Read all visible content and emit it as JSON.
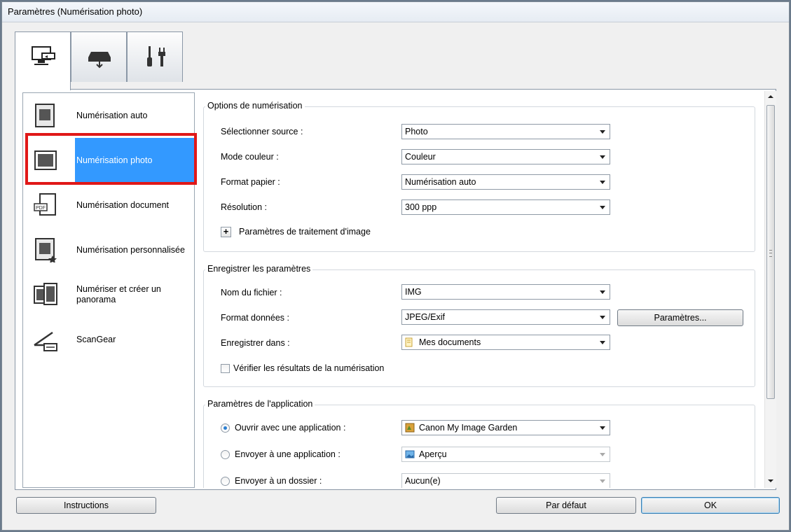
{
  "window": {
    "title": "Paramètres (Numérisation photo)"
  },
  "tabs": [
    {
      "icon": "scan-from-computer-icon",
      "active": true
    },
    {
      "icon": "scan-from-panel-icon",
      "active": false
    },
    {
      "icon": "general-settings-icon",
      "active": false
    }
  ],
  "sidebar": {
    "items": [
      {
        "label": "Numérisation auto",
        "icon": "auto-scan-icon"
      },
      {
        "label": "Numérisation photo",
        "icon": "photo-scan-icon",
        "selected": true
      },
      {
        "label": "Numérisation document",
        "icon": "document-scan-icon"
      },
      {
        "label": "Numérisation personnalisée",
        "icon": "custom-scan-icon"
      },
      {
        "label_line1": "Numériser et créer un",
        "label_line2": "panorama",
        "icon": "panorama-icon"
      },
      {
        "label": "ScanGear",
        "icon": "scangear-icon"
      }
    ]
  },
  "scan_options": {
    "title": "Options de numérisation",
    "source": {
      "label": "Sélectionner source :",
      "value": "Photo"
    },
    "color_mode": {
      "label": "Mode couleur :",
      "value": "Couleur"
    },
    "paper_size": {
      "label": "Format papier :",
      "value": "Numérisation auto"
    },
    "resolution": {
      "label": "Résolution :",
      "value": "300 ppp"
    },
    "image_processing": {
      "label": "Paramètres de traitement d'image"
    }
  },
  "save_settings": {
    "title": "Enregistrer les paramètres",
    "file_name": {
      "label": "Nom du fichier :",
      "value": "IMG"
    },
    "data_format": {
      "label": "Format données :",
      "value": "JPEG/Exif",
      "button": "Paramètres..."
    },
    "save_in": {
      "label": "Enregistrer dans :",
      "value": "Mes documents"
    },
    "check_results": {
      "label": "Vérifier les résultats de la numérisation",
      "checked": false
    }
  },
  "app_settings": {
    "title": "Paramètres de l'application",
    "open_with": {
      "label": "Ouvrir avec une application :",
      "value": "Canon My Image Garden",
      "selected": true
    },
    "send_to_app": {
      "label": "Envoyer à une application :",
      "value": "Aperçu",
      "selected": false
    },
    "send_to_folder": {
      "label": "Envoyer à un dossier :",
      "value": "Aucun(e)",
      "selected": false
    }
  },
  "footer": {
    "instructions": "Instructions",
    "default": "Par défaut",
    "ok": "OK"
  },
  "colors": {
    "selection": "#3399ff",
    "highlight_box": "#e01818"
  }
}
